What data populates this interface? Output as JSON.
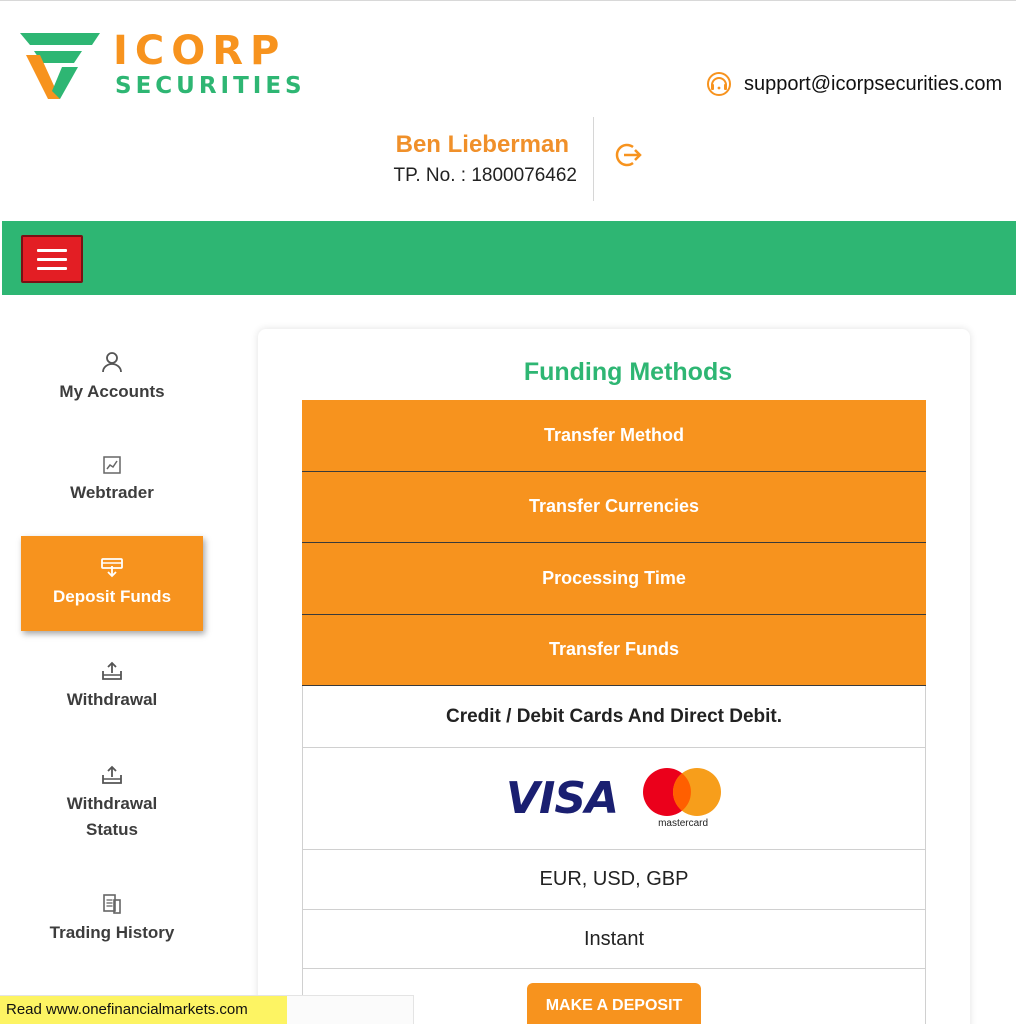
{
  "brand": {
    "name_top": "ICORP",
    "name_bottom": "SECURITIES",
    "orange": "#f7931e",
    "green": "#2eb673"
  },
  "header": {
    "support_email": "support@icorpsecurities.com",
    "support_icon": "headset-icon",
    "user_name": "Ben Lieberman",
    "tp_number": "TP. No. : 1800076462",
    "logout_icon": "logout-icon"
  },
  "topbar": {
    "menu_icon": "hamburger-icon"
  },
  "sidebar": {
    "items": [
      {
        "label": "My Accounts",
        "icon": "user-icon",
        "active": false
      },
      {
        "label": "Webtrader",
        "icon": "chart-icon",
        "active": false
      },
      {
        "label": "Deposit Funds",
        "icon": "deposit-icon",
        "active": true
      },
      {
        "label": "Withdrawal",
        "icon": "upload-tray-icon",
        "active": false
      },
      {
        "label": "Withdrawal Status",
        "icon": "upload-tray-icon",
        "active": false
      },
      {
        "label": "Trading History",
        "icon": "document-icon",
        "active": false
      }
    ],
    "withdrawal_status_line1": "Withdrawal",
    "withdrawal_status_line2": "Status"
  },
  "main": {
    "title": "Funding Methods",
    "headers": [
      "Transfer Method",
      "Transfer Currencies",
      "Processing Time",
      "Transfer Funds"
    ],
    "method_name": "Credit / Debit Cards And Direct Debit.",
    "card_logos": {
      "visa": "VISA",
      "mastercard": "mastercard"
    },
    "currencies": "EUR, USD, GBP",
    "processing_time": "Instant",
    "deposit_button": "MAKE A DEPOSIT"
  },
  "notice": {
    "text": "Read www.onefinancialmarkets.com",
    "highlight": "#fdf463"
  }
}
